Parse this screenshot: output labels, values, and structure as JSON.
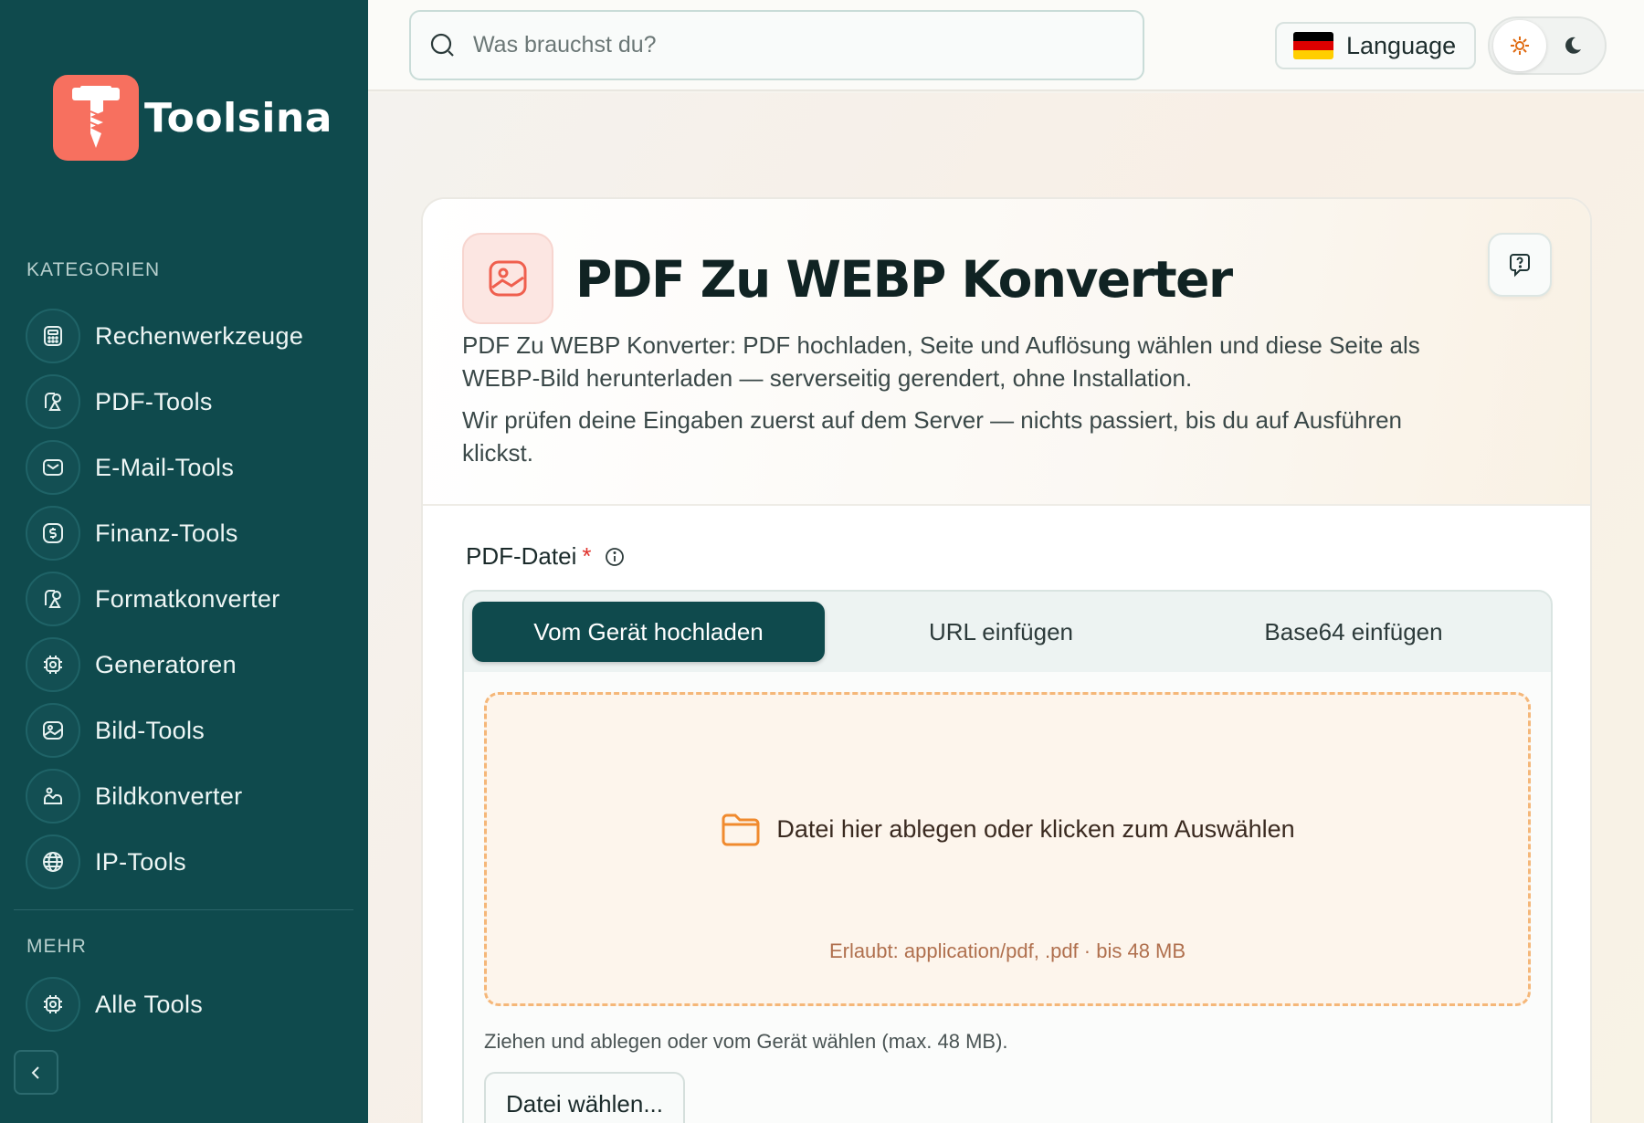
{
  "brand": {
    "name": "Toolsina",
    "accent": "#f7705f",
    "sidebar_bg": "#0f4a4d"
  },
  "sidebar": {
    "categories_title": "KATEGORIEN",
    "items": [
      {
        "label": "Rechenwerkzeuge",
        "icon": "calculator-icon"
      },
      {
        "label": "PDF-Tools",
        "icon": "shapes-icon"
      },
      {
        "label": "E-Mail-Tools",
        "icon": "mail-icon"
      },
      {
        "label": "Finanz-Tools",
        "icon": "dollar-icon"
      },
      {
        "label": "Formatkonverter",
        "icon": "shapes-icon"
      },
      {
        "label": "Generatoren",
        "icon": "chip-icon"
      },
      {
        "label": "Bild-Tools",
        "icon": "image-icon"
      },
      {
        "label": "Bildkonverter",
        "icon": "image-convert-icon"
      },
      {
        "label": "IP-Tools",
        "icon": "globe-icon"
      }
    ],
    "more_title": "MEHR",
    "more_items": [
      {
        "label": "Alle Tools",
        "icon": "chip-icon"
      }
    ]
  },
  "topbar": {
    "search_placeholder": "Was brauchst du?",
    "language_label": "Language",
    "theme_active": "light"
  },
  "tool": {
    "title": "PDF Zu WEBP Konverter",
    "description_1": "PDF Zu WEBP Konverter: PDF hochladen, Seite und Auflösung wählen und diese Seite als WEBP-Bild herunterladen — serverseitig gerendert, ohne Installation.",
    "description_2": "Wir prüfen deine Eingaben zuerst auf dem Server — nichts passiert, bis du auf Ausführen klickst.",
    "field_label": "PDF-Datei",
    "required_mark": "*",
    "tabs": [
      {
        "label": "Vom Gerät hochladen",
        "active": true
      },
      {
        "label": "URL einfügen",
        "active": false
      },
      {
        "label": "Base64 einfügen",
        "active": false
      }
    ],
    "dropzone_text": "Datei hier ablegen oder klicken zum Auswählen",
    "dropzone_hint": "Erlaubt: application/pdf, .pdf · bis 48 MB",
    "help_text": "Ziehen und ablegen oder vom Gerät wählen (max. 48 MB).",
    "choose_button": "Datei wählen..."
  }
}
